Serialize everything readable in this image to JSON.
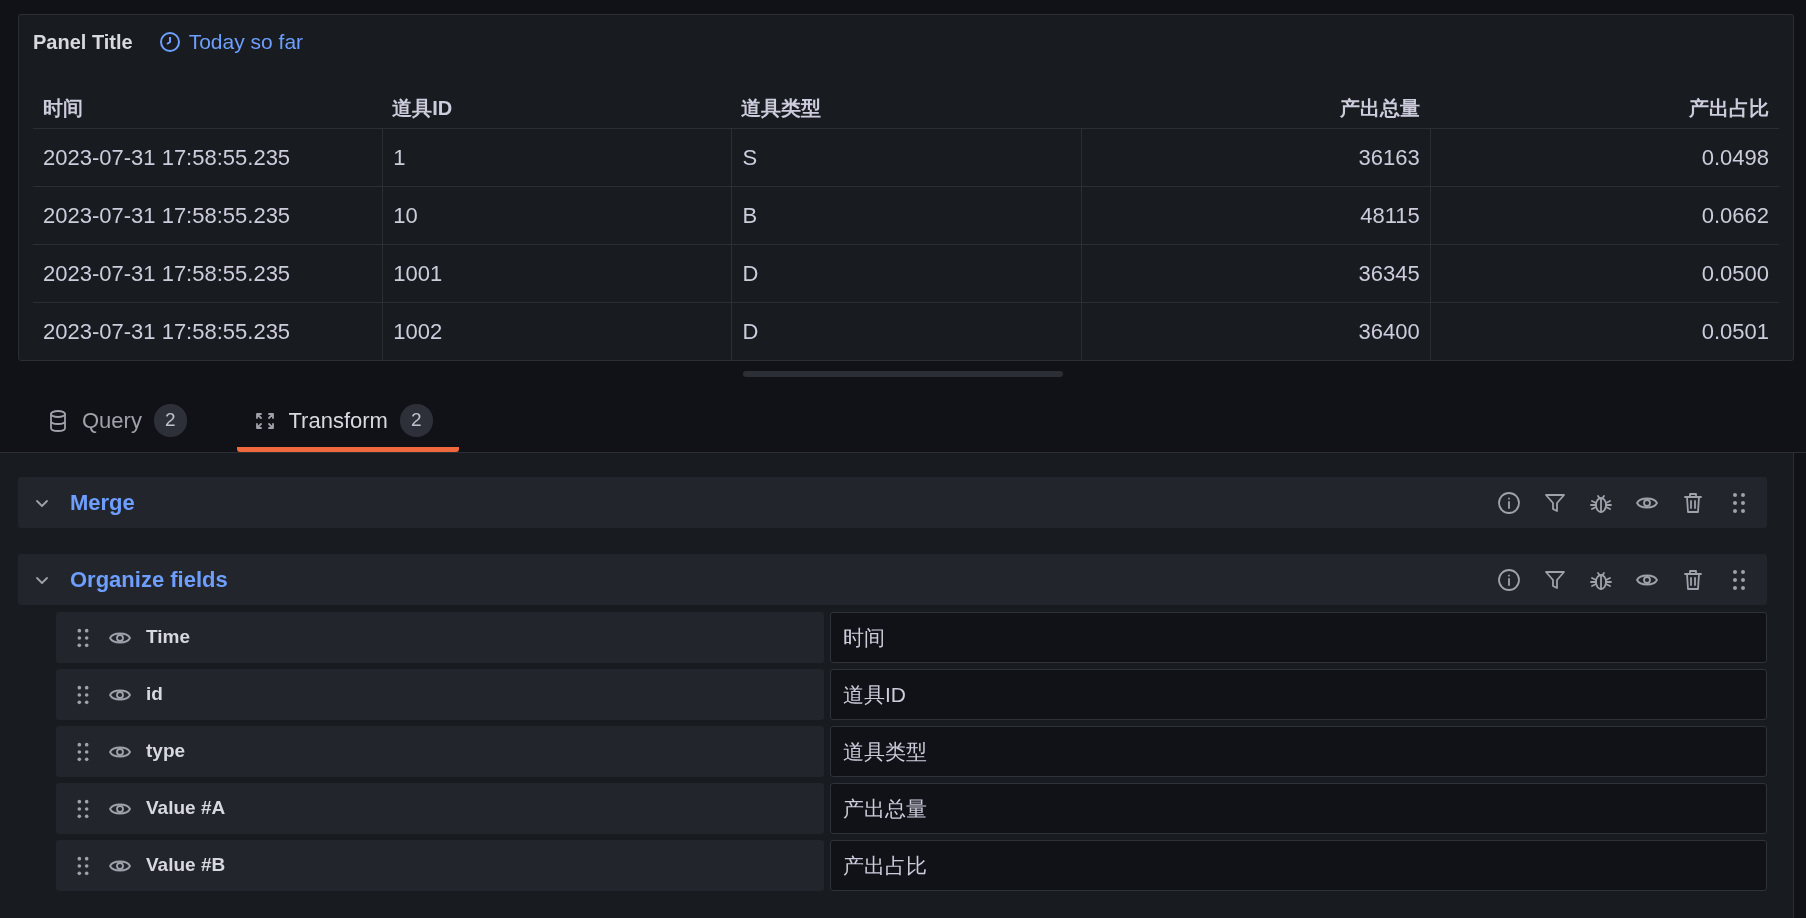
{
  "panel": {
    "title": "Panel Title",
    "time_range": "Today so far"
  },
  "table": {
    "columns": [
      {
        "label": "时间",
        "kind": "time"
      },
      {
        "label": "道具ID",
        "kind": "string"
      },
      {
        "label": "道具类型",
        "kind": "string"
      },
      {
        "label": "产出总量",
        "kind": "number"
      },
      {
        "label": "产出占比",
        "kind": "number"
      }
    ],
    "rows": [
      [
        "2023-07-31 17:58:55.235",
        "1",
        "S",
        "36163",
        "0.0498"
      ],
      [
        "2023-07-31 17:58:55.235",
        "10",
        "B",
        "48115",
        "0.0662"
      ],
      [
        "2023-07-31 17:58:55.235",
        "1001",
        "D",
        "36345",
        "0.0500"
      ],
      [
        "2023-07-31 17:58:55.235",
        "1002",
        "D",
        "36400",
        "0.0501"
      ]
    ]
  },
  "tabs": [
    {
      "label": "Query",
      "count": "2",
      "kind": "query",
      "selected": false
    },
    {
      "label": "Transform",
      "count": "2",
      "kind": "transform",
      "selected": true
    }
  ],
  "transformations": [
    {
      "name": "Merge"
    },
    {
      "name": "Organize fields",
      "fields": [
        {
          "name": "Time",
          "visible": true,
          "rename": "时间"
        },
        {
          "name": "id",
          "visible": true,
          "rename": "道具ID"
        },
        {
          "name": "type",
          "visible": true,
          "rename": "道具类型"
        },
        {
          "name": "Value #A",
          "visible": true,
          "rename": "产出总量"
        },
        {
          "name": "Value #B",
          "visible": true,
          "rename": "产出占比"
        }
      ]
    }
  ]
}
